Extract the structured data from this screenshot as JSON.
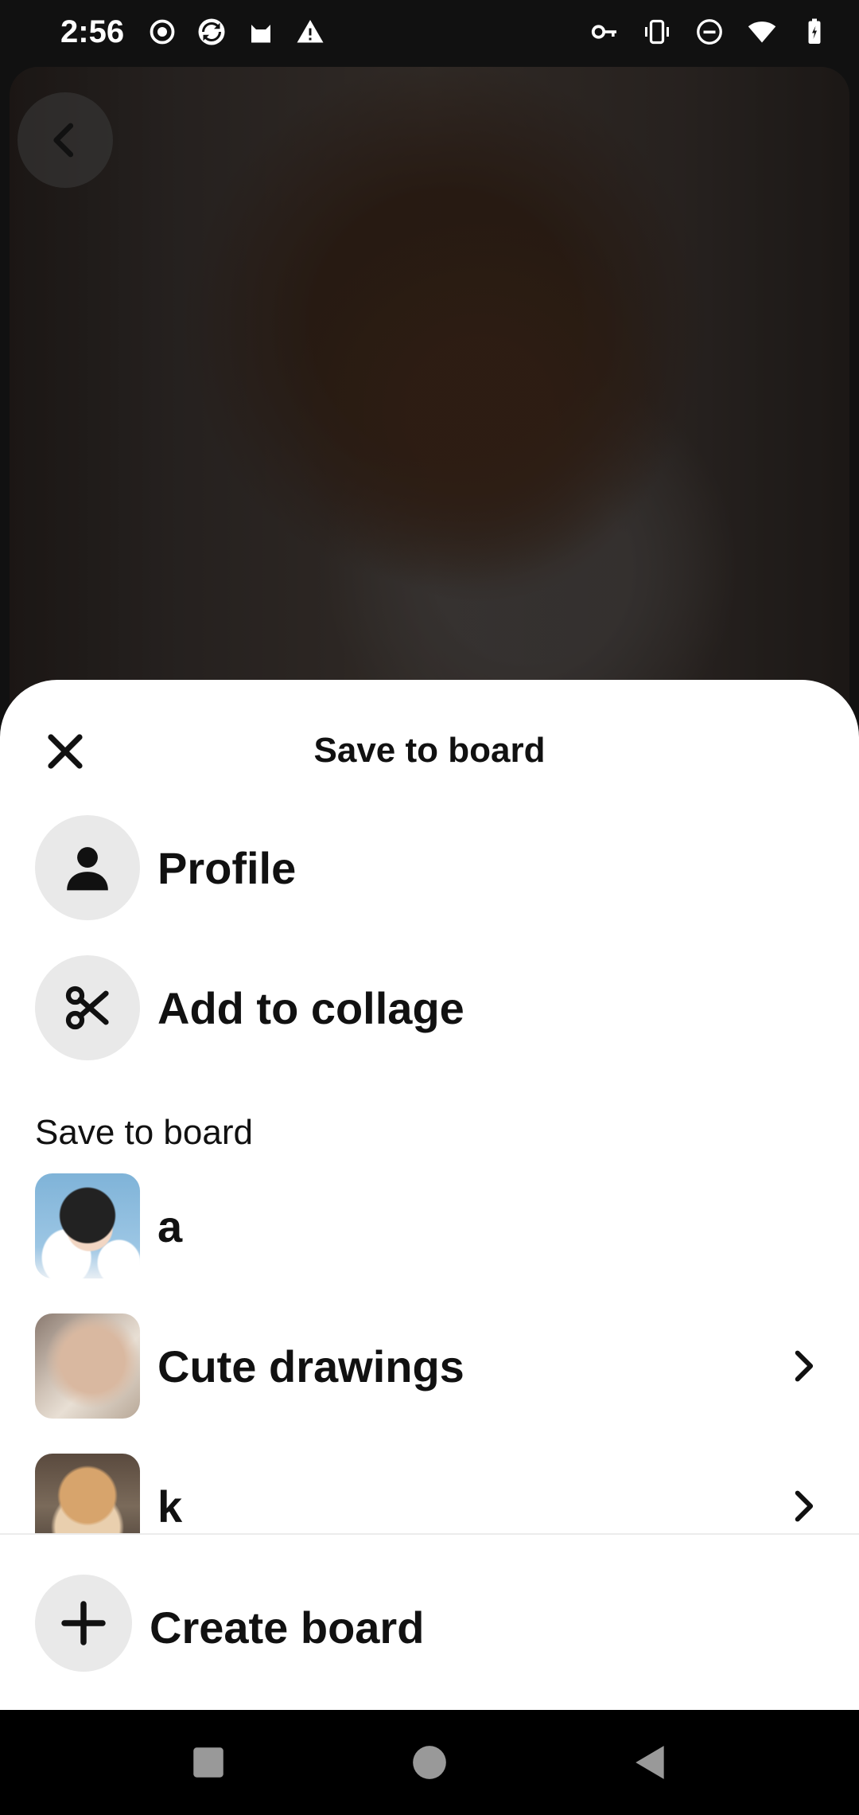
{
  "status_bar": {
    "time": "2:56",
    "left_icons": [
      "record-icon",
      "sync-icon",
      "cat-icon",
      "warning-icon"
    ],
    "right_icons": [
      "key-icon",
      "vibrate-icon",
      "dnd-icon",
      "wifi-icon",
      "battery-icon"
    ]
  },
  "sheet": {
    "title": "Save to board",
    "quick_actions": [
      {
        "label": "Profile",
        "icon": "person-icon"
      },
      {
        "label": "Add to collage",
        "icon": "scissors-icon"
      }
    ],
    "section_label": "Save to board",
    "boards": [
      {
        "name": "a",
        "has_chevron": false
      },
      {
        "name": "Cute drawings",
        "has_chevron": true
      },
      {
        "name": "k",
        "has_chevron": true
      }
    ],
    "create_label": "Create board"
  },
  "colors": {
    "sheet_bg": "#ffffff",
    "icon_circle": "#e9e9e9",
    "text": "#111111"
  }
}
